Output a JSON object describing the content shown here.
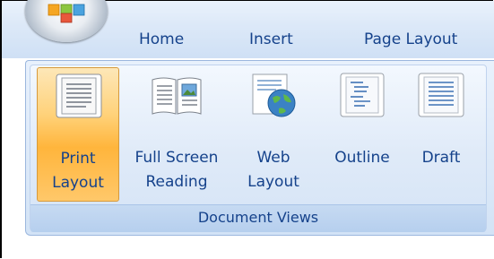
{
  "tabs": {
    "home": "Home",
    "insert": "Insert",
    "page_layout": "Page Layout"
  },
  "group": {
    "label": "Document Views",
    "buttons": [
      {
        "line1": "Print",
        "line2": "Layout",
        "icon": "print-layout-icon",
        "active": true
      },
      {
        "line1": "Full Screen",
        "line2": "Reading",
        "icon": "full-screen-reading-icon",
        "active": false
      },
      {
        "line1": "Web",
        "line2": "Layout",
        "icon": "web-layout-icon",
        "active": false
      },
      {
        "line1": "Outline",
        "line2": "",
        "icon": "outline-icon",
        "active": false
      },
      {
        "line1": "Draft",
        "line2": "",
        "icon": "draft-icon",
        "active": false
      }
    ]
  },
  "colors": {
    "tab_text": "#15428b",
    "active_fill": "#ffb53c",
    "ribbon": "#dce9f8"
  }
}
